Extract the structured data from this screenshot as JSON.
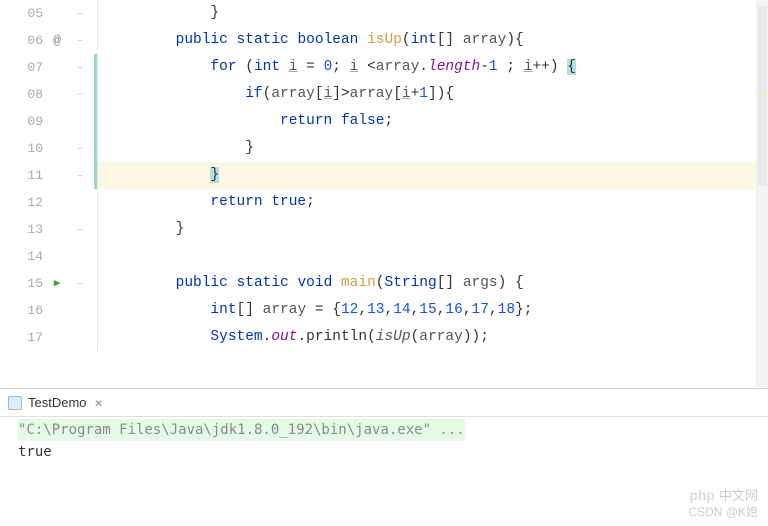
{
  "lines": [
    {
      "num": "05",
      "annot": "",
      "fold": "⊟",
      "cb": "",
      "hl": false,
      "html": "            }"
    },
    {
      "num": "06",
      "annot": "@",
      "fold": "⊟",
      "cb": "",
      "hl": false,
      "html": "        <span class='kw'>public</span> <span class='kw'>static</span> <span class='kw'>boolean</span> <span class='fn'>isUp</span>(<span class='kw'>int</span>[] <span class='var'>array</span>){"
    },
    {
      "num": "07",
      "annot": "",
      "fold": "⊟",
      "cb": "teal",
      "hl": false,
      "html": "            <span class='kw'>for</span> (<span class='kw'>int</span> <span class='var u'>i</span> = <span class='num'>0</span>; <span class='var u'>i</span> &lt;<span class='var'>array</span>.<span class='field'>length</span>-<span class='num'>1</span> ; <span class='var u'>i</span>++) <span class='cursor-hl'>{</span>"
    },
    {
      "num": "08",
      "annot": "",
      "fold": "⊟",
      "cb": "teal",
      "hl": false,
      "html": "                <span class='kw'>if</span>(<span class='var'>array</span>[<span class='var u'>i</span>]&gt;<span class='var'>array</span>[<span class='var u'>i</span>+<span class='num'>1</span>]){"
    },
    {
      "num": "09",
      "annot": "",
      "fold": "",
      "cb": "teal",
      "hl": false,
      "html": "                    <span class='kw'>return false</span>;"
    },
    {
      "num": "10",
      "annot": "",
      "fold": "⊟",
      "cb": "teal",
      "hl": false,
      "html": "                }"
    },
    {
      "num": "11",
      "annot": "",
      "fold": "⊟",
      "cb": "teal",
      "hl": true,
      "html": "            <span class='cursor-hl'>}</span>"
    },
    {
      "num": "12",
      "annot": "",
      "fold": "",
      "cb": "",
      "hl": false,
      "html": "            <span class='kw'>return true</span>;"
    },
    {
      "num": "13",
      "annot": "",
      "fold": "⊟",
      "cb": "",
      "hl": false,
      "html": "        }"
    },
    {
      "num": "14",
      "annot": "",
      "fold": "",
      "cb": "",
      "hl": false,
      "html": ""
    },
    {
      "num": "15",
      "annot": "▶",
      "fold": "⊟",
      "cb": "",
      "hl": false,
      "html": "        <span class='kw'>public</span> <span class='kw'>static</span> <span class='kw'>void</span> <span class='fn'>main</span>(<span class='type'>String</span>[] <span class='var'>args</span>) {"
    },
    {
      "num": "16",
      "annot": "",
      "fold": "",
      "cb": "",
      "hl": false,
      "html": "            <span class='kw'>int</span>[] <span class='var'>array</span> = {<span class='num'>12</span>,<span class='num'>13</span>,<span class='num'>14</span>,<span class='num'>15</span>,<span class='num'>16</span>,<span class='num'>17</span>,<span class='num'>18</span>};"
    },
    {
      "num": "17",
      "annot": "",
      "fold": "",
      "cb": "",
      "hl": false,
      "html": "            <span class='type'>System</span>.<span class='staticf'>out</span>.println(<span class='stcall'>isUp</span>(<span class='var'>array</span>));"
    }
  ],
  "tab": {
    "title": "TestDemo",
    "close": "×"
  },
  "console": {
    "cmd": "\"C:\\Program Files\\Java\\jdk1.8.0_192\\bin\\java.exe\" ...",
    "output": "true"
  },
  "watermark": "中文网",
  "wm_brand": "php",
  "credit": "CSDN @K媳"
}
